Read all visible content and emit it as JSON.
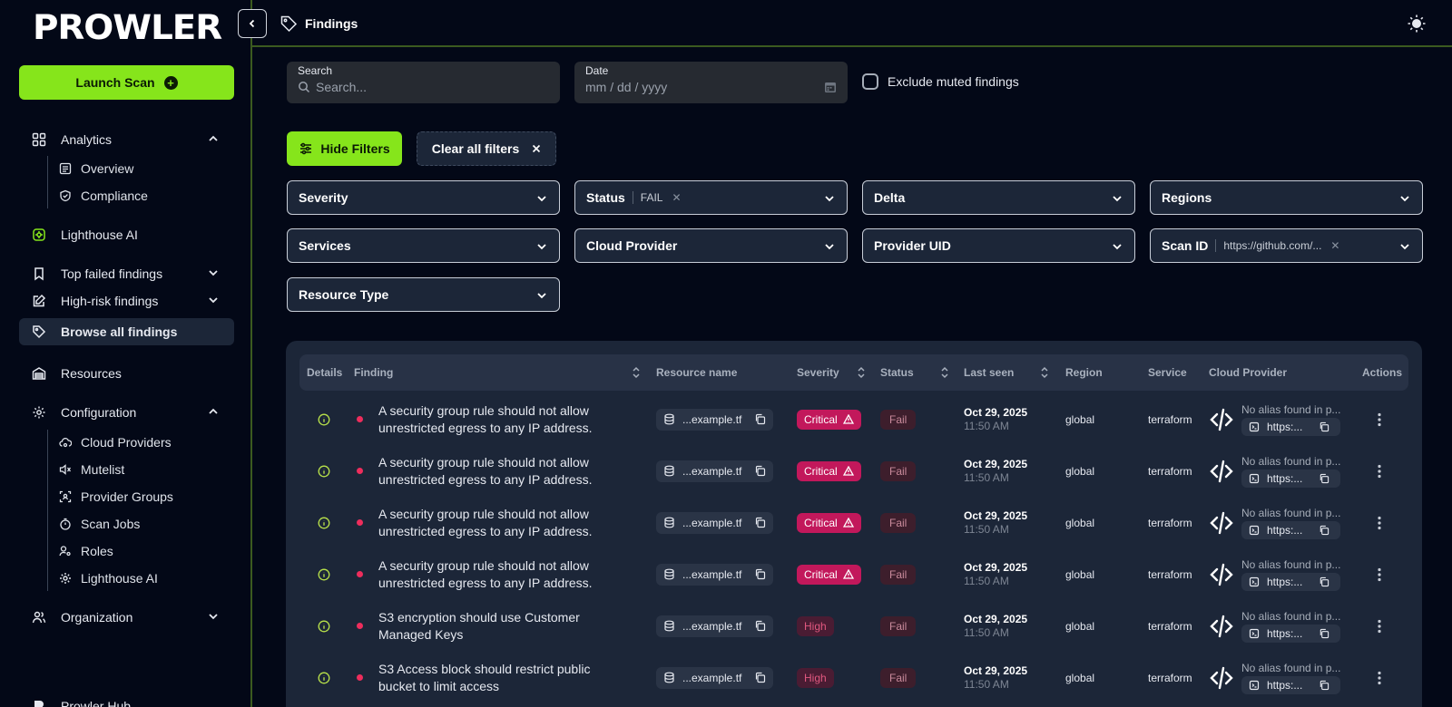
{
  "brand": {
    "logo_text": "PROWLER",
    "accent": "#86e51b"
  },
  "sidebar": {
    "launch_label": "Launch Scan",
    "analytics": {
      "label": "Analytics",
      "overview": "Overview",
      "compliance": "Compliance"
    },
    "lighthouse": "Lighthouse AI",
    "top_failed": "Top failed findings",
    "high_risk": "High-risk findings",
    "browse_all": "Browse all findings",
    "resources": "Resources",
    "configuration": {
      "label": "Configuration",
      "items": [
        "Cloud Providers",
        "Mutelist",
        "Provider Groups",
        "Scan Jobs",
        "Roles",
        "Lighthouse AI"
      ]
    },
    "organization": "Organization",
    "hub": "Prowler Hub"
  },
  "header": {
    "title": "Findings"
  },
  "search": {
    "label": "Search",
    "placeholder": "Search..."
  },
  "date": {
    "label": "Date",
    "placeholder": "mm / dd / yyyy"
  },
  "exclude_muted": "Exclude muted findings",
  "buttons": {
    "hide_filters": "Hide Filters",
    "clear_all": "Clear all filters"
  },
  "filters": {
    "severity": "Severity",
    "status": {
      "label": "Status",
      "value": "FAIL"
    },
    "delta": "Delta",
    "regions": "Regions",
    "services": "Services",
    "cloud_provider": "Cloud Provider",
    "provider_uid": "Provider UID",
    "scan_id": {
      "label": "Scan ID",
      "value": "https://github.com/..."
    },
    "resource_type": "Resource Type"
  },
  "table": {
    "headers": [
      "Details",
      "Finding",
      "Resource name",
      "Severity",
      "Status",
      "Last seen",
      "Region",
      "Service",
      "Cloud Provider",
      "Actions"
    ],
    "rows": [
      {
        "finding": "A security group rule should not allow unrestricted egress to any IP address.",
        "resource": "...example.tf",
        "severity": "Critical",
        "status": "Fail",
        "date": "Oct 29, 2025",
        "time": "11:50 AM",
        "region": "global",
        "service": "terraform",
        "alias": "No alias found in p...",
        "uid": "https:..."
      },
      {
        "finding": "A security group rule should not allow unrestricted egress to any IP address.",
        "resource": "...example.tf",
        "severity": "Critical",
        "status": "Fail",
        "date": "Oct 29, 2025",
        "time": "11:50 AM",
        "region": "global",
        "service": "terraform",
        "alias": "No alias found in p...",
        "uid": "https:..."
      },
      {
        "finding": "A security group rule should not allow unrestricted egress to any IP address.",
        "resource": "...example.tf",
        "severity": "Critical",
        "status": "Fail",
        "date": "Oct 29, 2025",
        "time": "11:50 AM",
        "region": "global",
        "service": "terraform",
        "alias": "No alias found in p...",
        "uid": "https:..."
      },
      {
        "finding": "A security group rule should not allow unrestricted egress to any IP address.",
        "resource": "...example.tf",
        "severity": "Critical",
        "status": "Fail",
        "date": "Oct 29, 2025",
        "time": "11:50 AM",
        "region": "global",
        "service": "terraform",
        "alias": "No alias found in p...",
        "uid": "https:..."
      },
      {
        "finding": "S3 encryption should use Customer Managed Keys",
        "resource": "...example.tf",
        "severity": "High",
        "status": "Fail",
        "date": "Oct 29, 2025",
        "time": "11:50 AM",
        "region": "global",
        "service": "terraform",
        "alias": "No alias found in p...",
        "uid": "https:..."
      },
      {
        "finding": "S3 Access block should restrict public bucket to limit access",
        "resource": "...example.tf",
        "severity": "High",
        "status": "Fail",
        "date": "Oct 29, 2025",
        "time": "11:50 AM",
        "region": "global",
        "service": "terraform",
        "alias": "No alias found in p...",
        "uid": "https:..."
      }
    ]
  }
}
